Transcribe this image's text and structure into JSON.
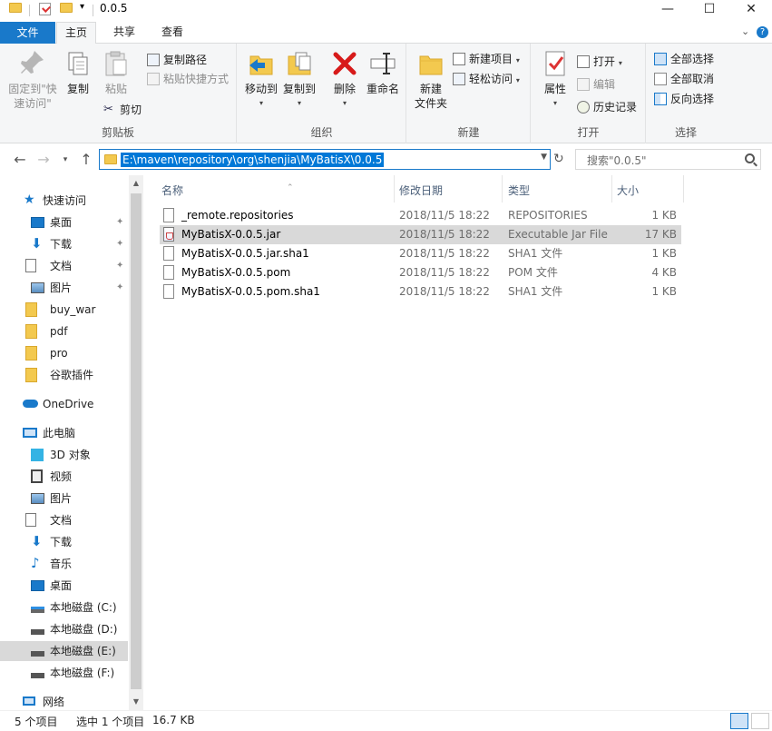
{
  "window": {
    "title": "0.0.5",
    "minimize": "—",
    "maximize": "☐",
    "close": "✕"
  },
  "tabs": {
    "file": "文件",
    "home": "主页",
    "share": "共享",
    "view": "查看"
  },
  "ribbon": {
    "clipboard": {
      "label": "剪贴板",
      "pin_quick": "固定到\"快速访问\"",
      "copy": "复制",
      "paste": "粘贴",
      "copy_path": "复制路径",
      "paste_shortcut": "粘贴快捷方式",
      "cut": "剪切"
    },
    "organize": {
      "label": "组织",
      "move_to": "移动到",
      "copy_to": "复制到",
      "delete": "删除",
      "rename": "重命名"
    },
    "new": {
      "label": "新建",
      "new_folder": "新建\n文件夹",
      "new_item": "新建项目",
      "easy_access": "轻松访问"
    },
    "open": {
      "label": "打开",
      "properties": "属性",
      "open": "打开",
      "edit": "编辑",
      "history": "历史记录"
    },
    "select": {
      "label": "选择",
      "select_all": "全部选择",
      "select_none": "全部取消",
      "invert": "反向选择"
    }
  },
  "address": {
    "path": "E:\\maven\\repository\\org\\shenjia\\MyBatisX\\0.0.5",
    "search_placeholder": "搜索\"0.0.5\""
  },
  "nav": {
    "quick_access": "快速访问",
    "items": [
      {
        "label": "桌面",
        "icon": "desktop-icon",
        "pinned": true
      },
      {
        "label": "下载",
        "icon": "download-icon",
        "pinned": true
      },
      {
        "label": "文档",
        "icon": "document-icon",
        "pinned": true
      },
      {
        "label": "图片",
        "icon": "picture-icon",
        "pinned": true
      },
      {
        "label": "buy_war",
        "icon": "folder-icon",
        "pinned": false
      },
      {
        "label": "pdf",
        "icon": "folder-icon",
        "pinned": false
      },
      {
        "label": "pro",
        "icon": "folder-icon",
        "pinned": false
      },
      {
        "label": "谷歌插件",
        "icon": "folder-icon",
        "pinned": false
      }
    ],
    "onedrive": "OneDrive",
    "this_pc": "此电脑",
    "pc_items": [
      {
        "label": "3D 对象",
        "icon": "3d-objects-icon"
      },
      {
        "label": "视频",
        "icon": "video-icon"
      },
      {
        "label": "图片",
        "icon": "picture-icon"
      },
      {
        "label": "文档",
        "icon": "document-icon"
      },
      {
        "label": "下载",
        "icon": "download-icon"
      },
      {
        "label": "音乐",
        "icon": "music-icon"
      },
      {
        "label": "桌面",
        "icon": "desktop-icon"
      },
      {
        "label": "本地磁盘 (C:)",
        "icon": "system-drive-icon"
      },
      {
        "label": "本地磁盘 (D:)",
        "icon": "drive-icon"
      },
      {
        "label": "本地磁盘 (E:)",
        "icon": "drive-icon"
      },
      {
        "label": "本地磁盘 (F:)",
        "icon": "drive-icon"
      }
    ],
    "network": "网络",
    "selected_label": "本地磁盘 (E:)"
  },
  "columns": {
    "name": "名称",
    "date": "修改日期",
    "type": "类型",
    "size": "大小"
  },
  "files": [
    {
      "name": "_remote.repositories",
      "date": "2018/11/5 18:22",
      "type": "REPOSITORIES",
      "size": "1 KB",
      "icon": "file-icon"
    },
    {
      "name": "MyBatisX-0.0.5.jar",
      "date": "2018/11/5 18:22",
      "type": "Executable Jar File",
      "size": "17 KB",
      "icon": "jar-file-icon",
      "selected": true
    },
    {
      "name": "MyBatisX-0.0.5.jar.sha1",
      "date": "2018/11/5 18:22",
      "type": "SHA1 文件",
      "size": "1 KB",
      "icon": "file-icon"
    },
    {
      "name": "MyBatisX-0.0.5.pom",
      "date": "2018/11/5 18:22",
      "type": "POM 文件",
      "size": "4 KB",
      "icon": "file-icon"
    },
    {
      "name": "MyBatisX-0.0.5.pom.sha1",
      "date": "2018/11/5 18:22",
      "type": "SHA1 文件",
      "size": "1 KB",
      "icon": "file-icon"
    }
  ],
  "status": {
    "count": "5 个项目",
    "selection": "选中 1 个项目",
    "size": "16.7 KB"
  },
  "colors": {
    "accent": "#1979ca",
    "selection": "#d9d9d9",
    "addr_highlight": "#0078d7"
  }
}
